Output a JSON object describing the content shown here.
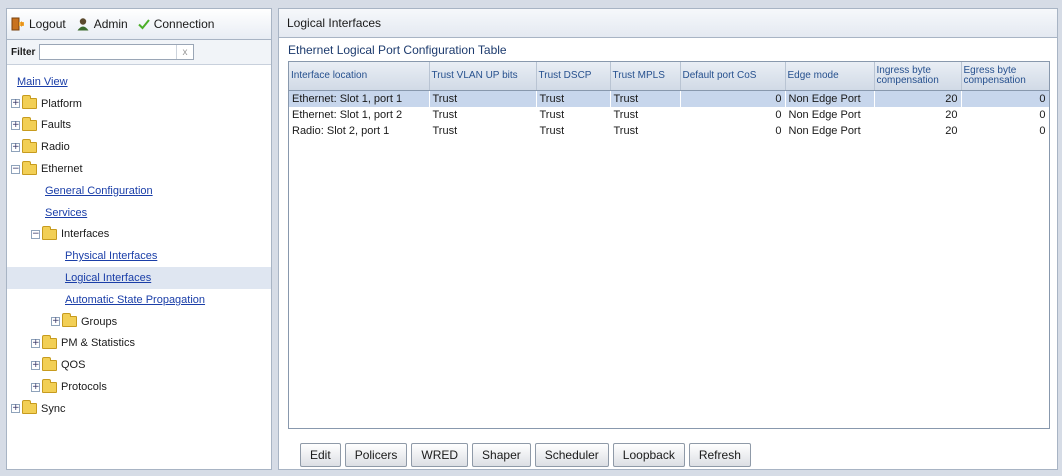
{
  "topbar": {
    "logout_label": "Logout",
    "admin_label": "Admin",
    "connection_label": "Connection"
  },
  "filter": {
    "label": "Filter",
    "value": "",
    "placeholder": "",
    "clear_glyph": "x"
  },
  "tree": {
    "main_view": "Main View",
    "platform": "Platform",
    "faults": "Faults",
    "radio": "Radio",
    "ethernet": "Ethernet",
    "general_configuration": "General Configuration",
    "services": "Services",
    "interfaces": "Interfaces",
    "physical_interfaces": "Physical Interfaces",
    "logical_interfaces": "Logical Interfaces",
    "automatic_state_propagation": "Automatic State Propagation",
    "groups": "Groups",
    "pm_statistics": "PM & Statistics",
    "qos": "QOS",
    "protocols": "Protocols",
    "sync": "Sync"
  },
  "main": {
    "title": "Logical Interfaces",
    "table_caption": "Ethernet Logical Port Configuration Table",
    "columns": [
      "Interface location",
      "Trust VLAN UP bits",
      "Trust DSCP",
      "Trust MPLS",
      "Default port CoS",
      "Edge mode",
      "Ingress byte compensation",
      "Egress byte compensation"
    ],
    "rows": [
      [
        "Ethernet: Slot 1, port 1",
        "Trust",
        "Trust",
        "Trust",
        "0",
        "Non Edge Port",
        "20",
        "0"
      ],
      [
        "Ethernet: Slot 1, port 2",
        "Trust",
        "Trust",
        "Trust",
        "0",
        "Non Edge Port",
        "20",
        "0"
      ],
      [
        "Radio: Slot 2, port 1",
        "Trust",
        "Trust",
        "Trust",
        "0",
        "Non Edge Port",
        "20",
        "0"
      ]
    ]
  },
  "buttons": {
    "edit": "Edit",
    "policers": "Policers",
    "wred": "WRED",
    "shaper": "Shaper",
    "scheduler": "Scheduler",
    "loopback": "Loopback",
    "refresh": "Refresh"
  },
  "colors": {
    "link": "#1a3ea8",
    "header_text": "#26508e",
    "selected_row": "#c7d6ec",
    "folder": "#f2cf55"
  },
  "icons": {
    "logout": "logout-door-icon",
    "admin": "user-icon",
    "connection": "checkmark-icon",
    "folder": "folder-icon",
    "expand": "plus-expander-icon",
    "collapse": "minus-expander-icon"
  }
}
